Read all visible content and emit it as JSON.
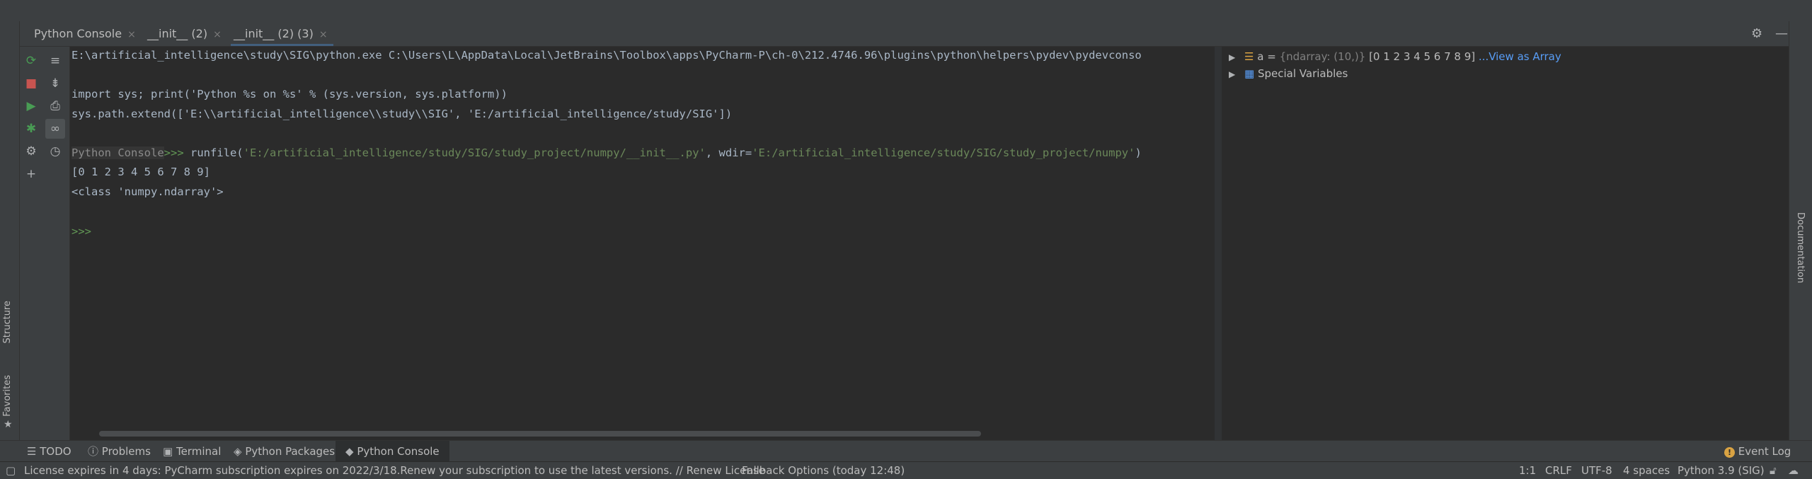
{
  "editor_tabs": [
    {
      "label": "Python Console",
      "active": false
    },
    {
      "label": "__init__ (2)",
      "active": false
    },
    {
      "label": "__init__ (2) (3)",
      "active": true
    }
  ],
  "close_glyph": "×",
  "left_stripe": {
    "structure": "Structure",
    "favorites": "Favorites"
  },
  "right_stripe": {
    "documentation": "Documentation"
  },
  "console": {
    "line1": "E:\\artificial_intelligence\\study\\SIG\\python.exe C:\\Users\\L\\AppData\\Local\\JetBrains\\Toolbox\\apps\\PyCharm-P\\ch-0\\212.4746.96\\plugins\\python\\helpers\\pydev\\pydevconso",
    "line2": "import sys; print('Python %s on %s' % (sys.version, sys.platform))",
    "line3": "sys.path.extend(['E:\\\\artificial_intelligence\\\\study\\\\SIG', 'E:/artificial_intelligence/study/SIG'])",
    "prompt_label": "Python Console",
    "prompt_arrows": ">>>",
    "runfile_prefix": " runfile(",
    "runfile_arg1": "'E:/artificial_intelligence/study/SIG/study_project/numpy/__init__.py'",
    "runfile_mid": ", wdir=",
    "runfile_arg2": "'E:/artificial_intelligence/study/SIG/study_project/numpy'",
    "runfile_end": ")",
    "output1": "[0 1 2 3 4 5 6 7 8 9]",
    "output2": "<class 'numpy.ndarray'>",
    "empty_prompt": ">>>"
  },
  "variables": {
    "var_a_name": "a",
    "var_a_eq": " = ",
    "var_a_type": "{ndarray: (10,)}",
    "var_a_value": " [0 1 2 3 4 5 6 7 8 9]",
    "var_a_link": " ...View as Array",
    "special": "Special Variables"
  },
  "bottom_tools": {
    "todo": "TODO",
    "problems": "Problems",
    "terminal": "Terminal",
    "python_packages": "Python Packages",
    "python_console": "Python Console",
    "event_log": "Event Log"
  },
  "status": {
    "message": "License expires in 4 days: PyCharm subscription expires on 2022/3/18.Renew your subscription to use the latest versions. // Renew License",
    "fallback": "Fallback Options (today 12:48)",
    "position": "1:1",
    "line_sep": "CRLF",
    "encoding": "UTF-8",
    "indent": "4 spaces",
    "interpreter": "Python 3.9 (SIG)"
  },
  "colors": {
    "background": "#2b2b2b",
    "panel": "#3c3f41",
    "prompt_green": "#629755",
    "string_green": "#6a8759",
    "link_blue": "#589df6",
    "run_green": "#499c54",
    "stop_red": "#c75450"
  }
}
